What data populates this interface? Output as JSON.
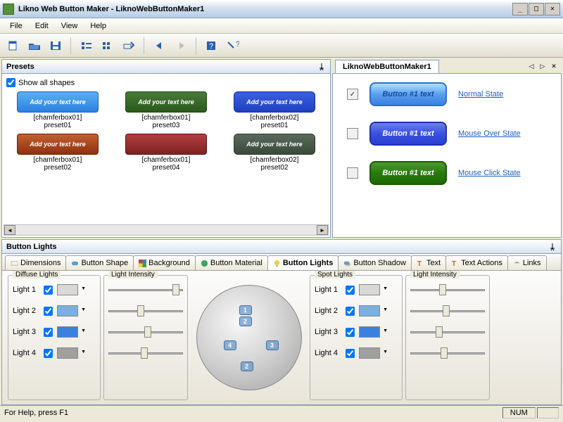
{
  "title": "Likno Web Button Maker - LiknoWebButtonMaker1",
  "menu": {
    "file": "File",
    "edit": "Edit",
    "view": "View",
    "help": "Help"
  },
  "panels": {
    "presets": "Presets",
    "showall": "Show all shapes",
    "preview_tab": "LiknoWebButtonMaker1",
    "lights": "Button Lights"
  },
  "presets": [
    {
      "btn": "Add your text here",
      "cap1": "[chamferbox01]",
      "cap2": "preset01"
    },
    {
      "btn": "Add your text here",
      "cap1": "[chamferbox01]",
      "cap2": "preset03"
    },
    {
      "btn": "Add your text here",
      "cap1": "[chamferbox02]",
      "cap2": "preset01"
    },
    {
      "btn": "Add your text here",
      "cap1": "[chamferbox01]",
      "cap2": "preset02"
    },
    {
      "btn": "",
      "cap1": "[chamferbox01]",
      "cap2": "preset04"
    },
    {
      "btn": "Add your text here",
      "cap1": "[chamferbox02]",
      "cap2": "preset02"
    }
  ],
  "states": {
    "btn_text": "Button #1 text",
    "normal": "Normal State",
    "over": "Mouse Over State",
    "click": "Mouse Click State"
  },
  "tabs": {
    "dimensions": "Dimensions",
    "shape": "Button Shape",
    "background": "Background",
    "material": "Button Material",
    "lights": "Button Lights",
    "shadow": "Button Shadow",
    "text": "Text",
    "textactions": "Text Actions",
    "links": "Links"
  },
  "lights": {
    "diffuse": "Diffuse Lights",
    "spot": "Spot Lights",
    "intensity": "Light Intensity",
    "rows": [
      "Light 1",
      "Light 2",
      "Light 3",
      "Light 4"
    ],
    "colors_diffuse": [
      "#d8d8d8",
      "#7ab0e0",
      "#3a80e0",
      "#a0a0a0"
    ],
    "colors_spot": [
      "#d8d8d8",
      "#7ab0e0",
      "#3a80e0",
      "#a0a0a0"
    ],
    "thumb_diffuse": [
      90,
      40,
      50,
      45
    ],
    "thumb_spot": [
      40,
      45,
      35,
      42
    ]
  },
  "status": {
    "help": "For Help, press F1",
    "num": "NUM"
  }
}
